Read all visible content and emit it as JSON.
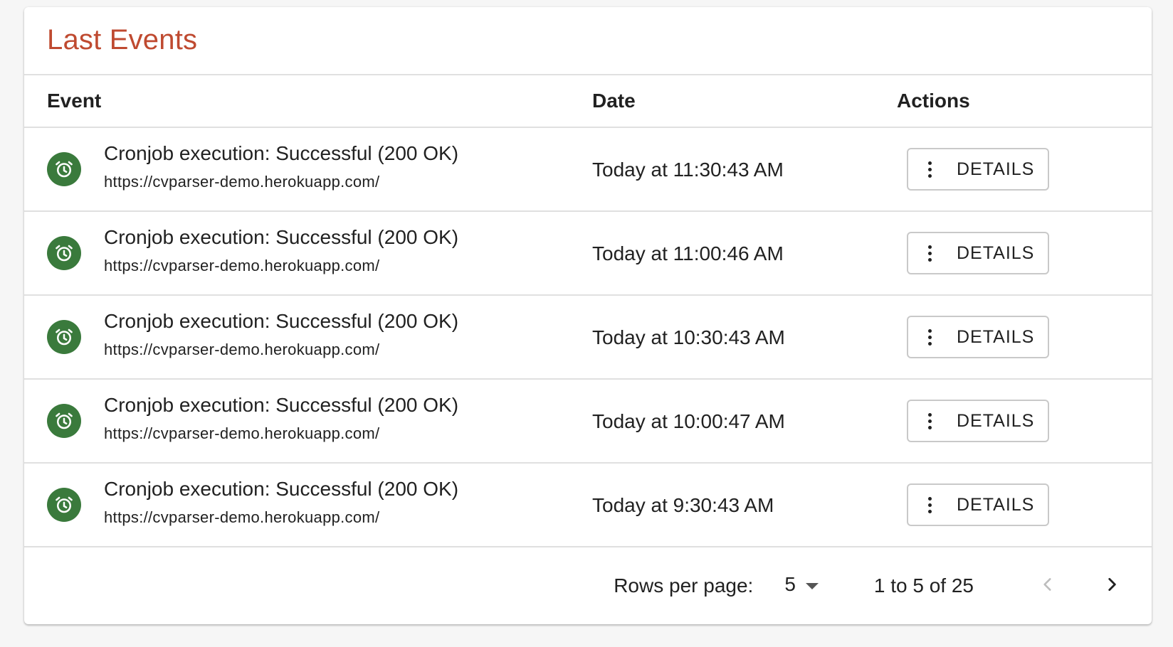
{
  "card": {
    "title": "Last Events"
  },
  "table": {
    "headers": {
      "event": "Event",
      "date": "Date",
      "actions": "Actions"
    },
    "rows": [
      {
        "title": "Cronjob execution: Successful (200 OK)",
        "url": "https://cvparser-demo.herokuapp.com/",
        "date": "Today at 11:30:43 AM",
        "action": "DETAILS"
      },
      {
        "title": "Cronjob execution: Successful (200 OK)",
        "url": "https://cvparser-demo.herokuapp.com/",
        "date": "Today at 11:00:46 AM",
        "action": "DETAILS"
      },
      {
        "title": "Cronjob execution: Successful (200 OK)",
        "url": "https://cvparser-demo.herokuapp.com/",
        "date": "Today at 10:30:43 AM",
        "action": "DETAILS"
      },
      {
        "title": "Cronjob execution: Successful (200 OK)",
        "url": "https://cvparser-demo.herokuapp.com/",
        "date": "Today at 10:00:47 AM",
        "action": "DETAILS"
      },
      {
        "title": "Cronjob execution: Successful (200 OK)",
        "url": "https://cvparser-demo.herokuapp.com/",
        "date": "Today at 9:30:43 AM",
        "action": "DETAILS"
      }
    ],
    "row_icon": "alarm-clock-icon",
    "action_icon": "more-vertical-icon"
  },
  "pagination": {
    "rows_per_page_label": "Rows per page:",
    "rows_per_page_value": "5",
    "range_text": "1 to 5 of 25",
    "prev_icon": "chevron-left-icon",
    "next_icon": "chevron-right-icon"
  },
  "colors": {
    "title": "#bf4a30",
    "icon_background": "#3a7a3c",
    "divider": "#e0e0e0",
    "disabled_nav": "#bdbdbd"
  }
}
